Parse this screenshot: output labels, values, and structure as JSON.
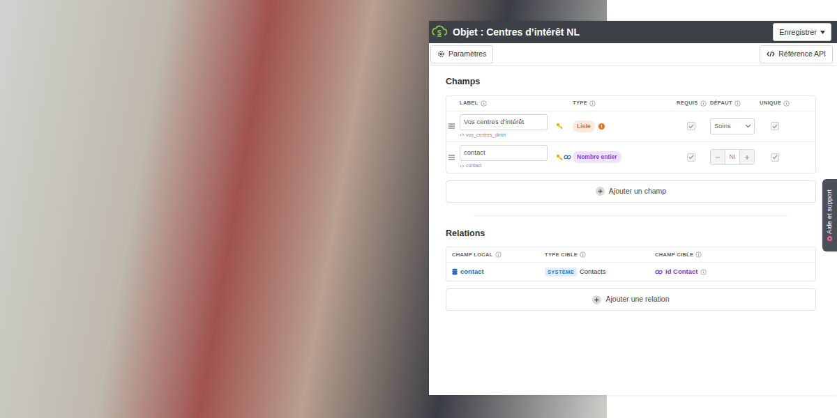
{
  "window": {
    "title": "Objet : Centres d’intérêt NL"
  },
  "header": {
    "save": "Enregistrer"
  },
  "toolbar": {
    "settings": "Paramètres",
    "api": "Référence API"
  },
  "fields": {
    "title": "Champs",
    "columns": [
      "LABEL",
      "TYPE",
      "REQUIS",
      "DÉFAUT",
      "UNIQUE"
    ],
    "rows": [
      {
        "label": "Vos centres d’intérêt",
        "key": "vos_centres_dintrt",
        "type": "Liste",
        "color": "#e0701e",
        "warning": true,
        "linked": false,
        "kind": "select",
        "required": true,
        "default": "Soins",
        "unique": true
      },
      {
        "label": "contact",
        "key": "contact",
        "type": "Nombre entier",
        "color": "#8e44d6",
        "warning": false,
        "linked": true,
        "kind": "number",
        "required": true,
        "default": "NI",
        "unique": true
      }
    ],
    "add": "Ajouter un champ"
  },
  "relations": {
    "title": "Relations",
    "columns": [
      "CHAMP LOCAL",
      "TYPE CIBLE",
      "CHAMP CIBLE"
    ],
    "rows": [
      {
        "local": "contact",
        "badge": "SYSTÈME",
        "target_type": "Contacts",
        "target_field": "Id Contact"
      }
    ],
    "add": "Ajouter une relation"
  },
  "help": {
    "label": "Aide et support"
  }
}
